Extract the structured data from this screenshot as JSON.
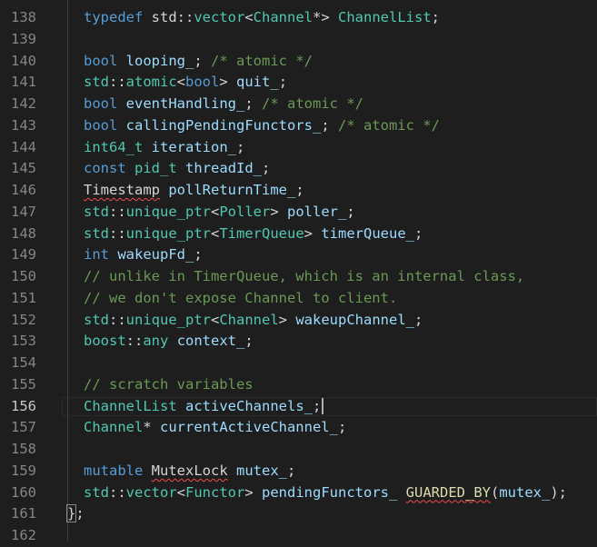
{
  "editor": {
    "current_line": "156",
    "lines": [
      {
        "num": "138",
        "segs": [
          {
            "c": "k",
            "t": "typedef"
          },
          {
            "c": "t",
            "t": " std::"
          },
          {
            "c": "ty",
            "t": "vector"
          },
          {
            "c": "t",
            "t": "<"
          },
          {
            "c": "ty",
            "t": "Channel"
          },
          {
            "c": "t",
            "t": "*> "
          },
          {
            "c": "ty",
            "t": "ChannelList"
          },
          {
            "c": "t",
            "t": ";"
          }
        ]
      },
      {
        "num": "139",
        "segs": []
      },
      {
        "num": "140",
        "segs": [
          {
            "c": "k",
            "t": "bool"
          },
          {
            "c": "t",
            "t": " "
          },
          {
            "c": "v",
            "t": "looping_"
          },
          {
            "c": "t",
            "t": "; "
          },
          {
            "c": "c",
            "t": "/* atomic */"
          }
        ]
      },
      {
        "num": "141",
        "segs": [
          {
            "c": "ty",
            "t": "std"
          },
          {
            "c": "t",
            "t": "::"
          },
          {
            "c": "ty",
            "t": "atomic"
          },
          {
            "c": "t",
            "t": "<"
          },
          {
            "c": "k",
            "t": "bool"
          },
          {
            "c": "t",
            "t": "> "
          },
          {
            "c": "v",
            "t": "quit_"
          },
          {
            "c": "t",
            "t": ";"
          }
        ]
      },
      {
        "num": "142",
        "segs": [
          {
            "c": "k",
            "t": "bool"
          },
          {
            "c": "t",
            "t": " "
          },
          {
            "c": "v",
            "t": "eventHandling_"
          },
          {
            "c": "t",
            "t": "; "
          },
          {
            "c": "c",
            "t": "/* atomic */"
          }
        ]
      },
      {
        "num": "143",
        "segs": [
          {
            "c": "k",
            "t": "bool"
          },
          {
            "c": "t",
            "t": " "
          },
          {
            "c": "v",
            "t": "callingPendingFunctors_"
          },
          {
            "c": "t",
            "t": "; "
          },
          {
            "c": "c",
            "t": "/* atomic */"
          }
        ]
      },
      {
        "num": "144",
        "segs": [
          {
            "c": "ty",
            "t": "int64_t"
          },
          {
            "c": "t",
            "t": " "
          },
          {
            "c": "v",
            "t": "iteration_"
          },
          {
            "c": "t",
            "t": ";"
          }
        ]
      },
      {
        "num": "145",
        "segs": [
          {
            "c": "k",
            "t": "const"
          },
          {
            "c": "t",
            "t": " "
          },
          {
            "c": "ty",
            "t": "pid_t"
          },
          {
            "c": "t",
            "t": " "
          },
          {
            "c": "v",
            "t": "threadId_"
          },
          {
            "c": "t",
            "t": ";"
          }
        ]
      },
      {
        "num": "146",
        "segs": [
          {
            "c": "t",
            "t": "Timestamp",
            "sq": true
          },
          {
            "c": "t",
            "t": " "
          },
          {
            "c": "v",
            "t": "pollReturnTime_"
          },
          {
            "c": "t",
            "t": ";"
          }
        ]
      },
      {
        "num": "147",
        "segs": [
          {
            "c": "ty",
            "t": "std"
          },
          {
            "c": "t",
            "t": "::"
          },
          {
            "c": "ty",
            "t": "unique_ptr"
          },
          {
            "c": "t",
            "t": "<"
          },
          {
            "c": "ty",
            "t": "Poller"
          },
          {
            "c": "t",
            "t": "> "
          },
          {
            "c": "v",
            "t": "poller_"
          },
          {
            "c": "t",
            "t": ";"
          }
        ]
      },
      {
        "num": "148",
        "segs": [
          {
            "c": "ty",
            "t": "std"
          },
          {
            "c": "t",
            "t": "::"
          },
          {
            "c": "ty",
            "t": "unique_ptr"
          },
          {
            "c": "t",
            "t": "<"
          },
          {
            "c": "ty",
            "t": "TimerQueue"
          },
          {
            "c": "t",
            "t": "> "
          },
          {
            "c": "v",
            "t": "timerQueue_"
          },
          {
            "c": "t",
            "t": ";"
          }
        ]
      },
      {
        "num": "149",
        "segs": [
          {
            "c": "k",
            "t": "int"
          },
          {
            "c": "t",
            "t": " "
          },
          {
            "c": "v",
            "t": "wakeupFd_"
          },
          {
            "c": "t",
            "t": ";"
          }
        ]
      },
      {
        "num": "150",
        "segs": [
          {
            "c": "c",
            "t": "// unlike in TimerQueue, which is an internal class,"
          }
        ]
      },
      {
        "num": "151",
        "segs": [
          {
            "c": "c",
            "t": "// we don't expose Channel to client."
          }
        ]
      },
      {
        "num": "152",
        "segs": [
          {
            "c": "ty",
            "t": "std"
          },
          {
            "c": "t",
            "t": "::"
          },
          {
            "c": "ty",
            "t": "unique_ptr"
          },
          {
            "c": "t",
            "t": "<"
          },
          {
            "c": "ty",
            "t": "Channel"
          },
          {
            "c": "t",
            "t": "> "
          },
          {
            "c": "v",
            "t": "wakeupChannel_"
          },
          {
            "c": "t",
            "t": ";"
          }
        ]
      },
      {
        "num": "153",
        "segs": [
          {
            "c": "ty",
            "t": "boost"
          },
          {
            "c": "t",
            "t": "::"
          },
          {
            "c": "ty",
            "t": "any"
          },
          {
            "c": "t",
            "t": " "
          },
          {
            "c": "v",
            "t": "context_"
          },
          {
            "c": "t",
            "t": ";"
          }
        ]
      },
      {
        "num": "154",
        "segs": []
      },
      {
        "num": "155",
        "segs": [
          {
            "c": "c",
            "t": "// scratch variables"
          }
        ]
      },
      {
        "num": "156",
        "segs": [
          {
            "c": "ty",
            "t": "ChannelList"
          },
          {
            "c": "t",
            "t": " "
          },
          {
            "c": "v",
            "t": "activeChannels_"
          },
          {
            "c": "t",
            "t": ";"
          }
        ],
        "cursor": true
      },
      {
        "num": "157",
        "segs": [
          {
            "c": "ty",
            "t": "Channel"
          },
          {
            "c": "t",
            "t": "* "
          },
          {
            "c": "v",
            "t": "currentActiveChannel_"
          },
          {
            "c": "t",
            "t": ";"
          }
        ]
      },
      {
        "num": "158",
        "segs": []
      },
      {
        "num": "159",
        "segs": [
          {
            "c": "k",
            "t": "mutable"
          },
          {
            "c": "t",
            "t": " "
          },
          {
            "c": "t",
            "t": "MutexLock",
            "sq": true
          },
          {
            "c": "t",
            "t": " "
          },
          {
            "c": "v",
            "t": "mutex_"
          },
          {
            "c": "t",
            "t": ";"
          }
        ]
      },
      {
        "num": "160",
        "segs": [
          {
            "c": "ty",
            "t": "std"
          },
          {
            "c": "t",
            "t": "::"
          },
          {
            "c": "ty",
            "t": "vector"
          },
          {
            "c": "t",
            "t": "<"
          },
          {
            "c": "ty",
            "t": "Functor"
          },
          {
            "c": "t",
            "t": "> "
          },
          {
            "c": "v",
            "t": "pendingFunctors_"
          },
          {
            "c": "t",
            "t": " "
          },
          {
            "c": "fn",
            "t": "GUARDED_BY",
            "sq": true
          },
          {
            "c": "t",
            "t": "("
          },
          {
            "c": "v",
            "t": "mutex_"
          },
          {
            "c": "t",
            "t": ");"
          }
        ]
      },
      {
        "num": "161",
        "segs": [
          {
            "c": "t",
            "t": "}"
          },
          {
            "c": "t",
            "t": ";"
          }
        ],
        "outdent": true,
        "brace": true
      },
      {
        "num": "162",
        "segs": []
      }
    ]
  }
}
